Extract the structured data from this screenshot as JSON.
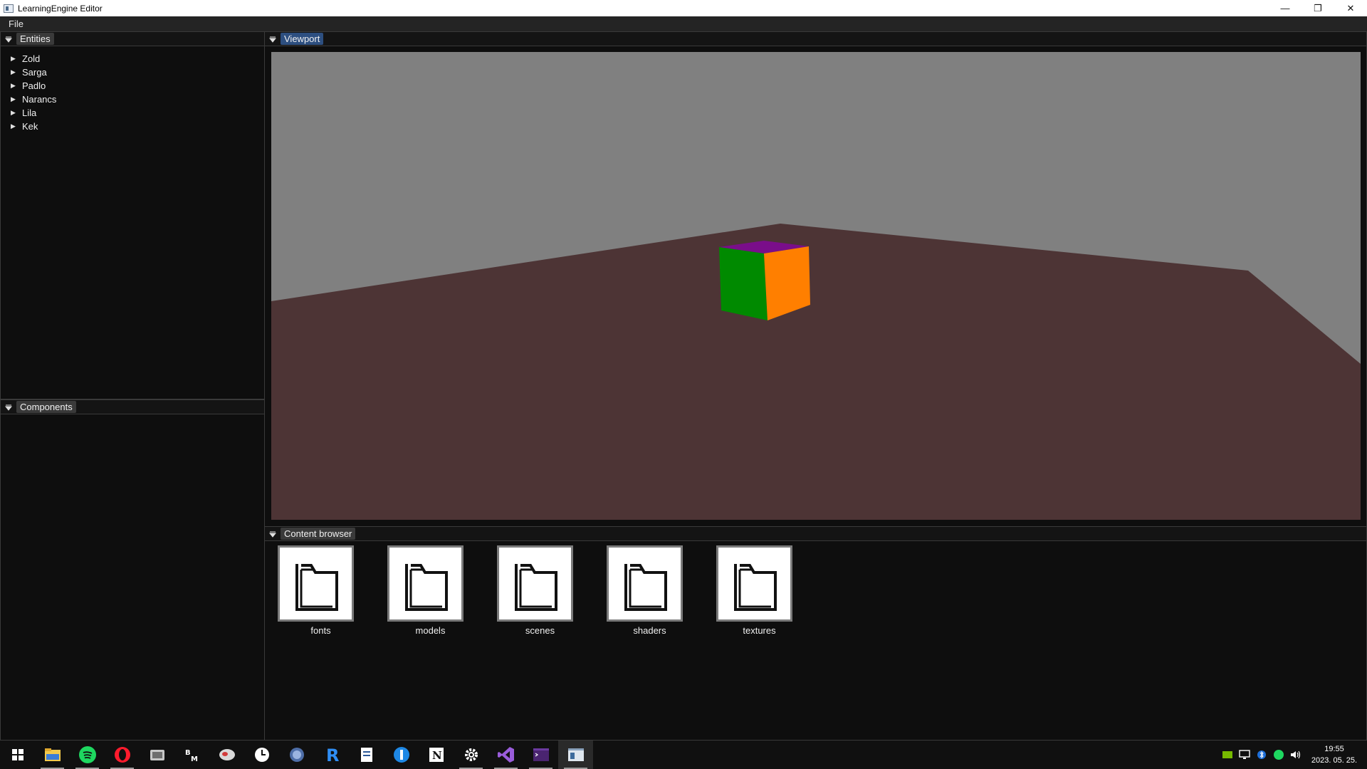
{
  "window": {
    "title": "LearningEngine Editor",
    "controls": {
      "minimize": "—",
      "restore": "❐",
      "close": "✕"
    }
  },
  "menubar": {
    "items": [
      "File"
    ]
  },
  "entities_panel": {
    "tab": "Entities",
    "items": [
      "Zold",
      "Sarga",
      "Padlo",
      "Narancs",
      "Lila",
      "Kek"
    ]
  },
  "components_panel": {
    "tab": "Components"
  },
  "viewport_panel": {
    "tab": "Viewport",
    "colors": {
      "sky": "#808080",
      "floor": "#4d3435",
      "cube_left": "#008a00",
      "cube_right": "#ff7f00",
      "cube_top": "#7a0e8a"
    }
  },
  "content_browser": {
    "tab": "Content browser",
    "folders": [
      "fonts",
      "models",
      "scenes",
      "shaders",
      "textures"
    ]
  },
  "taskbar": {
    "apps": [
      "windows-start",
      "file-explorer",
      "spotify",
      "opera",
      "app",
      "bm-app",
      "app",
      "clock-app",
      "app",
      "r-app",
      "notes",
      "app",
      "notion",
      "settings",
      "visual-studio",
      "terminal",
      "learning-engine"
    ],
    "time": "19:55",
    "date": "2023. 05. 25."
  },
  "accent": "#2d4f80"
}
